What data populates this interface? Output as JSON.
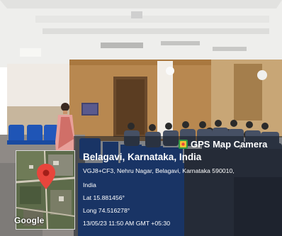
{
  "photo": {
    "scene": "seminar-hall"
  },
  "map_thumbnail": {
    "brand": "Google"
  },
  "stamp": {
    "app_name": "GPS Map Camera",
    "place": "Belagavi, Karnataka, India",
    "address_line": "VGJ8+CF3, Nehru Nagar, Belagavi, Karnataka 590010,",
    "country": "India",
    "latitude": "Lat 15.881456°",
    "longitude": "Long 74.516278°",
    "datetime": "13/05/23 11:50 AM GMT +05:30"
  },
  "colors": {
    "chair_blue": "#1f55b6",
    "wall_wood": "#b88850",
    "saree_pink": "#e8a09a",
    "pin_red": "#e8453c"
  }
}
